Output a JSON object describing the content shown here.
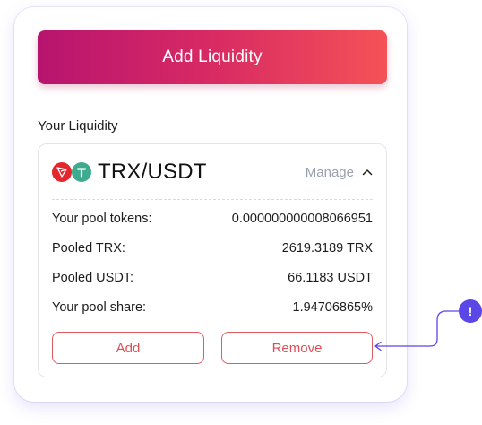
{
  "primary_action": {
    "label": "Add Liquidity"
  },
  "section": {
    "title": "Your Liquidity"
  },
  "pool": {
    "pair": "TRX/USDT",
    "manage_label": "Manage",
    "rows": [
      {
        "label": "Your pool tokens:",
        "value": "0.000000000008066951"
      },
      {
        "label": "Pooled TRX:",
        "value": "2619.3189 TRX"
      },
      {
        "label": "Pooled USDT:",
        "value": "66.1183 USDT"
      },
      {
        "label": "Your pool share:",
        "value": "1.94706865%"
      }
    ],
    "add_label": "Add",
    "remove_label": "Remove"
  },
  "hint": {
    "symbol": "!"
  },
  "icons": {
    "token_a": "trx-icon",
    "token_b": "usdt-icon",
    "manage": "chevron-up-icon"
  },
  "colors": {
    "gradient_start": "#b7146f",
    "gradient_end": "#f45257",
    "outline_button": "#e05a5f",
    "hint_badge": "#5b46e6"
  }
}
